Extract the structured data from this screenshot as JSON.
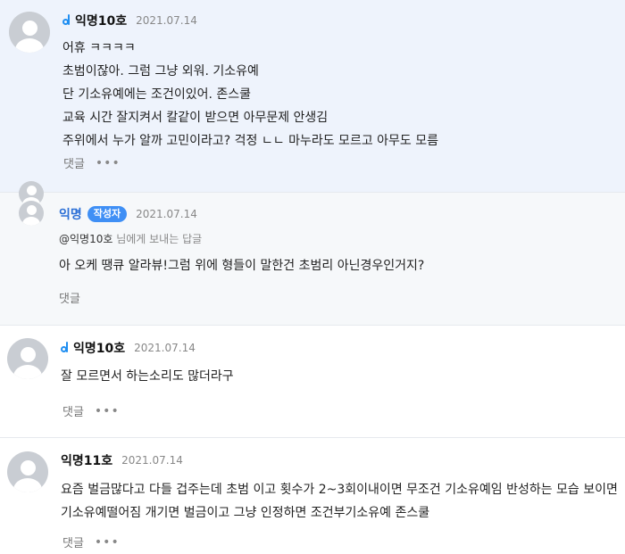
{
  "comments": [
    {
      "nickname": "익명10호",
      "date": "2021.07.14",
      "lines": [
        "어휴 ㅋㅋㅋㅋ",
        "초범이잖아. 그럼 그냥 외워. 기소유예",
        "단 기소유예에는 조건이있어. 존스쿨",
        "교육 시간 잘지켜서 칼같이 받으면 아무문제 안생김",
        "주위에서 누가 알까 고민이라고? 걱정 ㄴㄴ 마누라도 모르고 아무도 모름"
      ],
      "reply_label": "댓글",
      "more_label": "•••"
    },
    {
      "nickname": "익명",
      "badge": "작성자",
      "date": "2021.07.14",
      "reply_to_user": "@익명10호",
      "reply_to_suffix": " 님에게 보내는 답글",
      "lines": [
        "아 오케 땡큐 알라뷰!그럼 위에 형들이 말한건 초범리 아닌경우인거지?"
      ],
      "reply_label": "댓글",
      "more_label": "•••"
    },
    {
      "nickname": "익명10호",
      "date": "2021.07.14",
      "lines": [
        "잘 모르면서 하는소리도 많더라구"
      ],
      "reply_label": "댓글",
      "more_label": "•••"
    },
    {
      "nickname": "익명11호",
      "date": "2021.07.14",
      "lines": [
        "요즘 벌금많다고 다들 겁주는데 초범 이고 횟수가 2~3회이내이면 무조건 기소유예임 반성하는 모습 보이면",
        "기소유예떨어짐 개기면 벌금이고 그냥 인정하면 조건부기소유예 존스쿨"
      ],
      "reply_label": "댓글",
      "more_label": "•••"
    }
  ],
  "colors": {
    "highlight_bg": "#eef3fc",
    "reply_bg": "#f6f8fa",
    "badge_bg": "#3f8ff5",
    "author_name": "#2b6fd6",
    "vip_icon": "#1f8ef1"
  },
  "icons": {
    "avatar": "default-user-avatar-icon",
    "member_mark": "d-member-icon",
    "more": "more-dots-icon"
  }
}
